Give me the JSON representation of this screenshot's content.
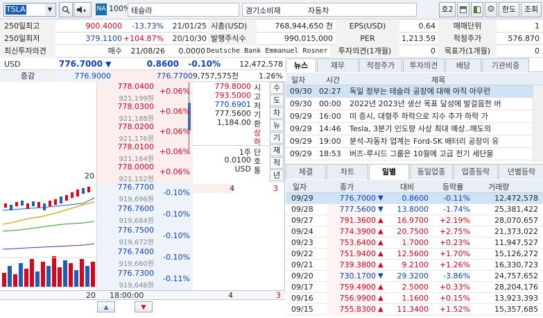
{
  "toolbar": {
    "code": "TSLA",
    "na_badge": "NA",
    "ratio": "100%",
    "name": "테슬라",
    "sector": "경기소비재",
    "industry": "자동차",
    "tab_no": "호2",
    "btn_hanto": "한도",
    "btn_lookup": "조회"
  },
  "info": {
    "r1": {
      "l1": "250일최고",
      "v1": "900.4000",
      "p1": "-13.73%",
      "d1": "21/01/25",
      "l2": "시총(USD)",
      "v2": "768,944,650 천",
      "l3": "EPS(USD)",
      "v3": "0.64",
      "l4": "매매단위",
      "v4": "1"
    },
    "r2": {
      "l1": "250일최저",
      "v1": "379.1100",
      "p1": "+104.87%",
      "d1": "20/10/30",
      "l2": "발행주식수",
      "v2": "990,015,000",
      "l3": "PER",
      "v3": "1,213.59",
      "l4": "적정주가",
      "v4": "576.870"
    },
    "r3": {
      "l1": "최신투자의견",
      "v1": "매수",
      "d1": "21/08/26",
      "n1": "0.0000",
      "broker": "Deutsche Bank Emmanuel Rosner",
      "l3": "투자의견(1개월)",
      "v3": "0",
      "l4": "목표가(1개월)",
      "v4": "0"
    }
  },
  "quote": {
    "currency": "USD",
    "price": "776.7000",
    "change": "0.8600",
    "rate": "-0.10%",
    "volume": "12,472,578",
    "lbl_chg": "증감",
    "ref1": "776.9000",
    "ref2": "776.7700",
    "amount": "9,757,575천",
    "ratio": "1.26%"
  },
  "asks": [
    {
      "price": "778.0400",
      "qty": "921,199원",
      "rate": "+0.06%"
    },
    {
      "price": "778.0300",
      "qty": "921,188원",
      "rate": "+0.06%"
    },
    {
      "price": "778.0200",
      "qty": "921,176원",
      "rate": "+0.06%"
    },
    {
      "price": "778.0100",
      "qty": "921,164원",
      "rate": "+0.06%"
    },
    {
      "price": "778.0000",
      "qty": "921,152원",
      "rate": "+0.06%"
    }
  ],
  "bids": [
    {
      "price": "776.7700",
      "qty": "919,696원",
      "rate": "-0.10%"
    },
    {
      "price": "776.7600",
      "qty": "919,684원",
      "rate": "-0.10%"
    },
    {
      "price": "776.7500",
      "qty": "919,672원",
      "rate": "-0.10%"
    },
    {
      "price": "776.7400",
      "qty": "919,660원",
      "rate": "-0.10%"
    },
    {
      "price": "776.7300",
      "qty": "919,648원",
      "rate": "-0.11%"
    }
  ],
  "ask_qty_total": "20",
  "bid_qty_1": "4",
  "bid_side_3": "3",
  "foot_qty": "20",
  "foot_time": "18:00:00",
  "foot_4": "4",
  "foot_3": "3",
  "ohlc": {
    "high": "779.8000",
    "open": "793.5000",
    "mid": "770.6901",
    "low": "777.5600",
    "base": "1,184.00"
  },
  "side_labels": {
    "a": "시",
    "b": "고",
    "c": "저",
    "d": "기",
    "e": "환",
    "f": "상",
    "g": "하"
  },
  "unit": {
    "l1": "1주",
    "l2": "0.0100",
    "l3": "USD",
    "s1": "단",
    "s2": "호",
    "s3": "통"
  },
  "side_btns": [
    "수",
    "도",
    "차",
    "뉴",
    "기",
    "재",
    "적",
    "년"
  ],
  "news_tabs": [
    "뉴스",
    "재무",
    "적정주가",
    "투자의견",
    "배당",
    "기관비중"
  ],
  "news_head": {
    "date": "일자",
    "time": "시간",
    "title": "제목"
  },
  "news": [
    {
      "date": "09/30",
      "time": "02:27",
      "title": "독일 정부는 테슬라 공장에 대해 아직 아무런"
    },
    {
      "date": "09/30",
      "time": "00:00",
      "title": "2022년 2023년 생산 목표 달성에 발걸음한 버"
    },
    {
      "date": "09/29",
      "time": "16:00",
      "title": "미 증시, 대형주 하락으로 지수 추가 하락 가"
    },
    {
      "date": "09/29",
      "time": "14:46",
      "title": "Tesla, 3분기 인도량 사상 최대 예상‥매도의"
    },
    {
      "date": "09/29",
      "time": "19:00",
      "title": "분석-자동차 업계는 Ford-SK 배터리 공장이 유"
    },
    {
      "date": "09/29",
      "time": "18:53",
      "title": "버즈-루시드 그룹은 10월에 고급 전기 세단을"
    }
  ],
  "daily_tabs": [
    "체결",
    "차트",
    "일별",
    "동일업종",
    "업종등락",
    "년별등락"
  ],
  "daily_head": {
    "date": "일자",
    "close": "종가",
    "diff": "대비",
    "rate": "등락률",
    "vol": "거래량"
  },
  "daily": [
    {
      "date": "09/29",
      "close": "776.7000",
      "dir": "down",
      "diff": "0.8600",
      "rate": "-0.11%",
      "vol": "12,472,578"
    },
    {
      "date": "09/28",
      "close": "777.5600",
      "dir": "down",
      "diff": "13.8000",
      "rate": "-1.74%",
      "vol": "25,381,422"
    },
    {
      "date": "09/27",
      "close": "791.3600",
      "dir": "up",
      "diff": "16.9700",
      "rate": "+2.19%",
      "vol": "28,070,657"
    },
    {
      "date": "09/24",
      "close": "774.3900",
      "dir": "up",
      "diff": "20.7500",
      "rate": "+2.75%",
      "vol": "21,373,022"
    },
    {
      "date": "09/23",
      "close": "753.6400",
      "dir": "up",
      "diff": "1.7000",
      "rate": "+0.23%",
      "vol": "11,947,527"
    },
    {
      "date": "09/22",
      "close": "751.9400",
      "dir": "up",
      "diff": "12.5600",
      "rate": "+1.70%",
      "vol": "15,126,272"
    },
    {
      "date": "09/21",
      "close": "739.3800",
      "dir": "up",
      "diff": "9.2100",
      "rate": "+1.26%",
      "vol": "16,330,723"
    },
    {
      "date": "09/20",
      "close": "730.1700",
      "dir": "down",
      "diff": "29.3200",
      "rate": "-3.86%",
      "vol": "24,757,652"
    },
    {
      "date": "09/17",
      "close": "759.4900",
      "dir": "up",
      "diff": "2.5000",
      "rate": "+0.33%",
      "vol": "28,204,176"
    },
    {
      "date": "09/16",
      "close": "756.9900",
      "dir": "up",
      "diff": "1.1600",
      "rate": "+0.15%",
      "vol": "13,923,393"
    },
    {
      "date": "09/15",
      "close": "755.8300",
      "dir": "up",
      "diff": "11.3400",
      "rate": "+1.52%",
      "vol": "15,357,685"
    }
  ],
  "colors": {
    "up": "#e0001b",
    "down": "#0a3fc0",
    "select": "#cfe3f7"
  }
}
